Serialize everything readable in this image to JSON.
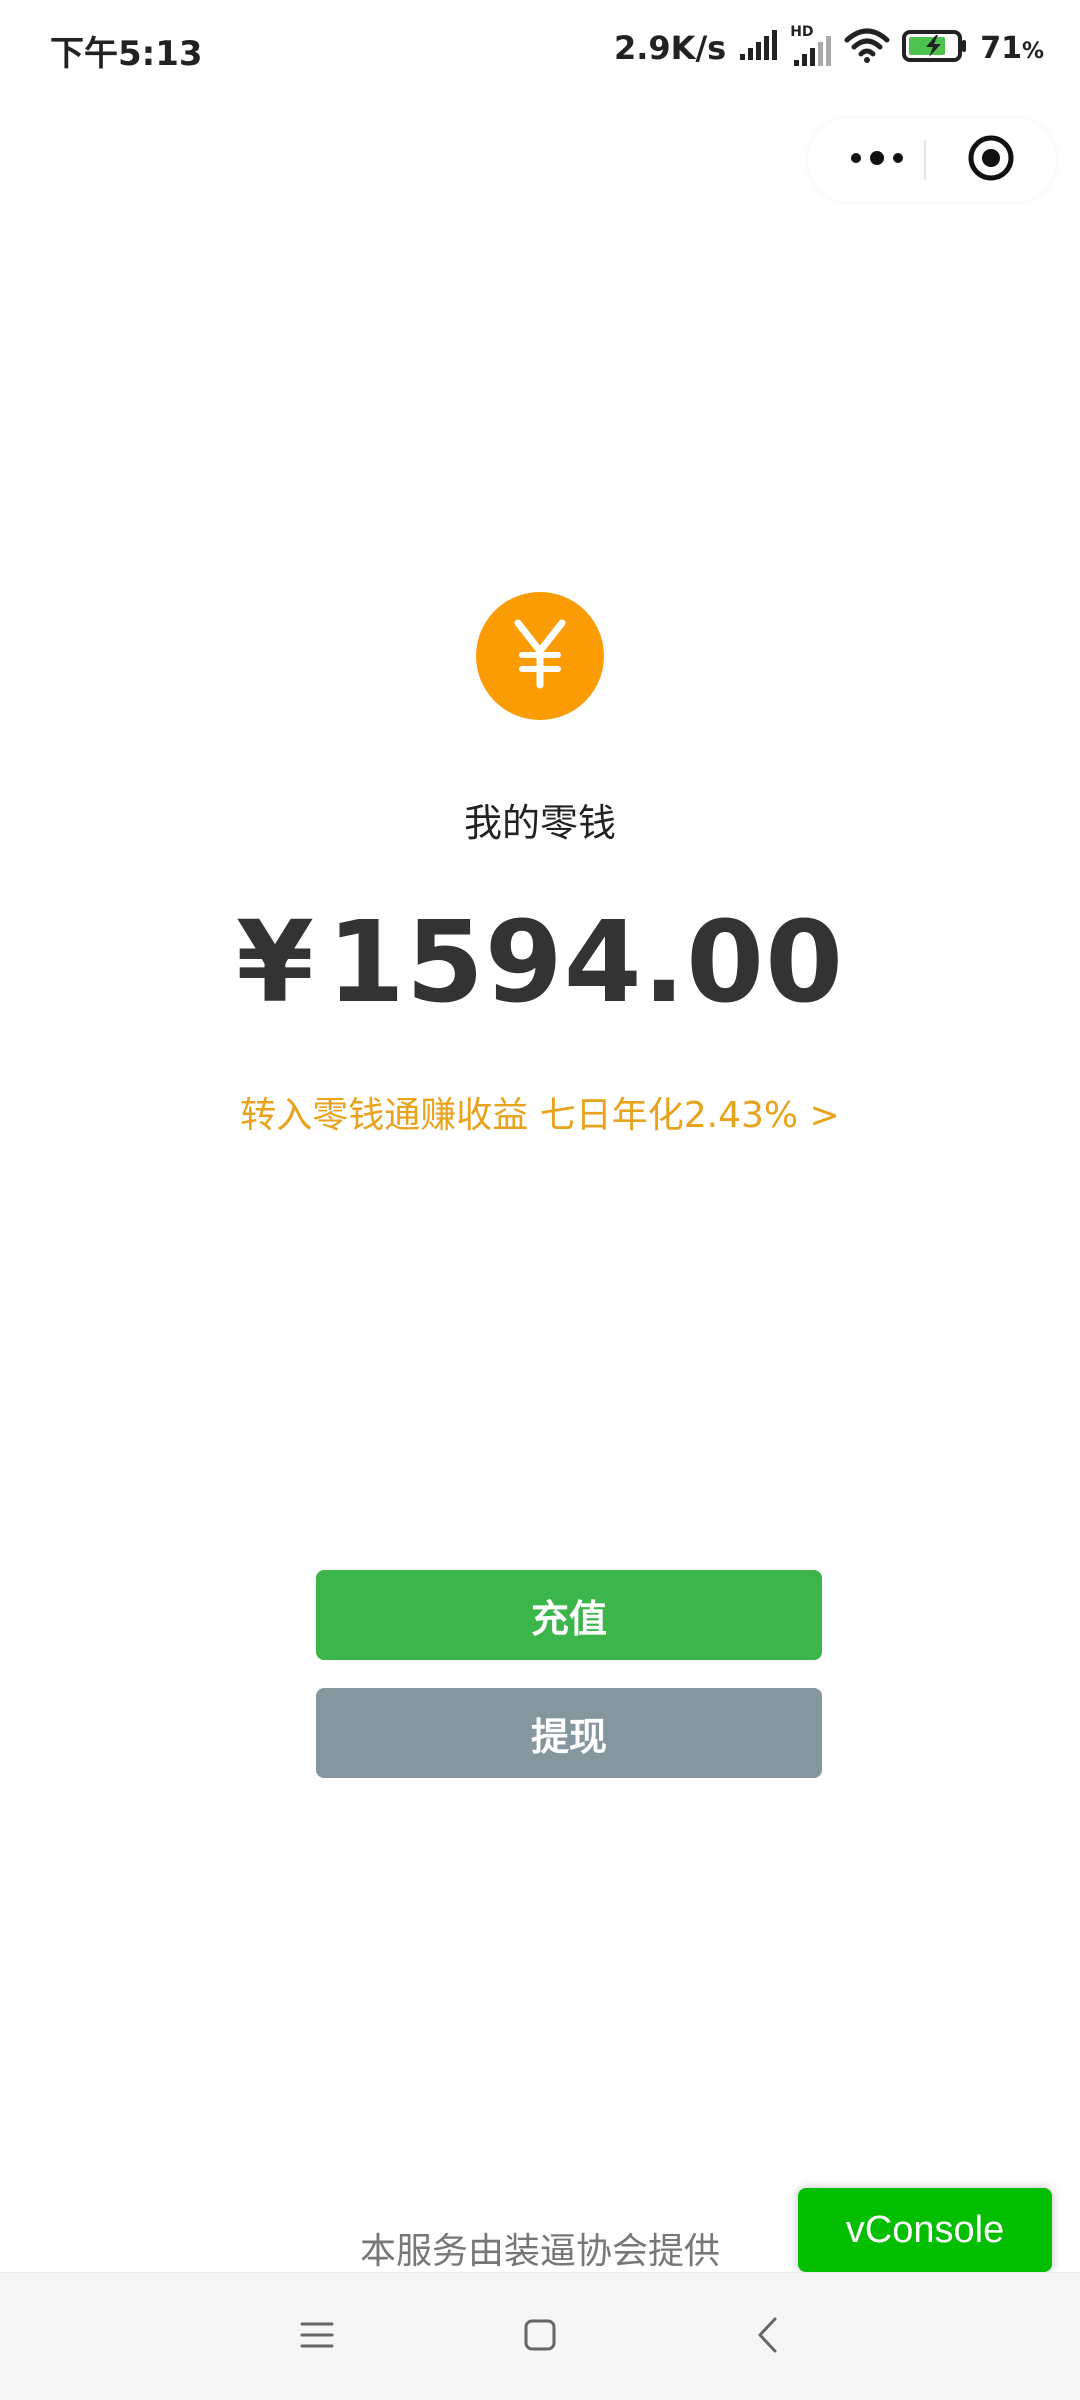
{
  "status_bar": {
    "time": "下午5:13",
    "net_speed": "2.9K/s",
    "signal_hd": "HD",
    "battery_pct": "71",
    "battery_unit": "%"
  },
  "capsule": {
    "more_icon": "more-dots-icon",
    "close_icon": "target-close-icon"
  },
  "wallet": {
    "coin_symbol": "¥",
    "label": "我的零钱",
    "currency": "¥",
    "amount": "1594.00",
    "earn_link": "转入零钱通赚收益 七日年化2.43% >"
  },
  "actions": {
    "recharge": "充值",
    "withdraw": "提现"
  },
  "footer": {
    "provider_note": "本服务由装逼协会提供"
  },
  "vconsole": {
    "label": "vConsole"
  },
  "colors": {
    "coin": "#fb9c05",
    "recharge": "#3cb54b",
    "withdraw": "#85969e",
    "earn_link": "#e8a21c",
    "vconsole": "#04be02"
  }
}
